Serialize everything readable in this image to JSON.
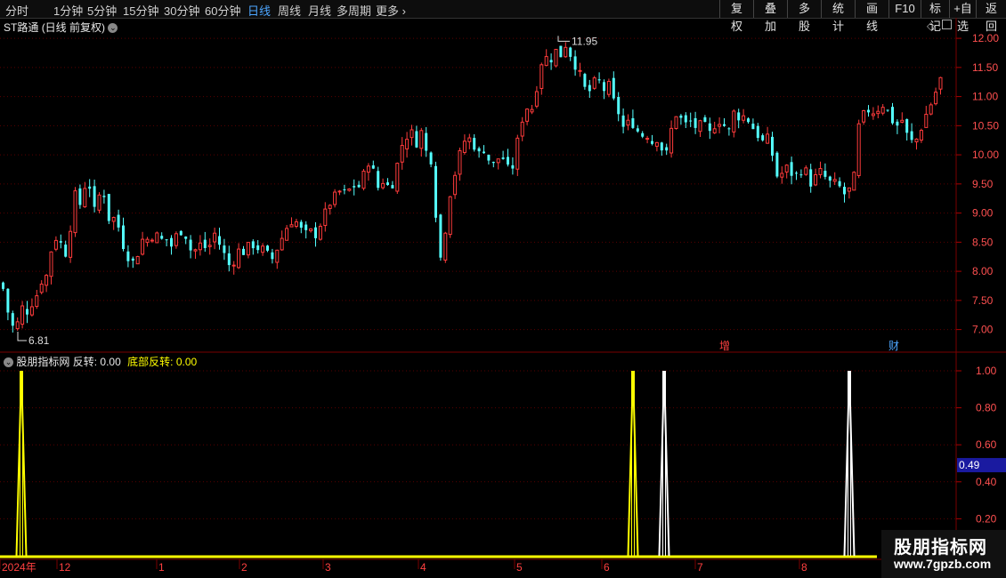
{
  "toolbar": {
    "periods": [
      "分时",
      "1分钟",
      "5分钟",
      "15分钟",
      "30分钟",
      "60分钟",
      "日线",
      "周线",
      "月线",
      "多周期",
      "更多"
    ],
    "active_period": "日线",
    "right_buttons": [
      "复权",
      "叠加",
      "多股",
      "统计",
      "画线",
      "F10",
      "标记",
      "+自选",
      "返回"
    ]
  },
  "main_chart": {
    "stock_title": "ST路通",
    "mode": "(日线 前复权)",
    "high_marker": "11.95",
    "low_marker": "6.81",
    "event_tags": [
      "增",
      "财"
    ],
    "colors": {
      "up": "#ff3b3b",
      "down": "#54ffff",
      "grid": "#5a0000"
    },
    "chart_data": {
      "type": "candlestick",
      "y_ticks": [
        "12.00",
        "11.50",
        "11.00",
        "10.50",
        "10.00",
        "9.50",
        "9.00",
        "8.50",
        "8.00",
        "7.50",
        "7.00"
      ],
      "ylim": [
        6.6,
        12.2
      ],
      "close_path": [
        [
          0,
          7.8
        ],
        [
          4,
          7.6
        ],
        [
          8,
          7.25
        ],
        [
          14,
          7.0
        ],
        [
          20,
          7.15
        ],
        [
          24,
          7.4
        ],
        [
          30,
          7.3
        ],
        [
          34,
          7.45
        ],
        [
          40,
          7.6
        ],
        [
          44,
          7.9
        ],
        [
          48,
          7.7
        ],
        [
          55,
          8.3
        ],
        [
          60,
          8.6
        ],
        [
          66,
          8.5
        ],
        [
          72,
          8.3
        ],
        [
          78,
          8.8
        ],
        [
          84,
          9.4
        ],
        [
          88,
          9.1
        ],
        [
          92,
          9.6
        ],
        [
          96,
          9.3
        ],
        [
          100,
          9.5
        ],
        [
          104,
          9.0
        ],
        [
          110,
          9.3
        ],
        [
          114,
          9.5
        ],
        [
          118,
          9.0
        ],
        [
          124,
          8.8
        ],
        [
          128,
          9.0
        ],
        [
          134,
          8.6
        ],
        [
          140,
          8.3
        ],
        [
          146,
          8.2
        ],
        [
          150,
          8.1
        ],
        [
          156,
          8.5
        ],
        [
          162,
          8.6
        ],
        [
          166,
          8.5
        ],
        [
          172,
          8.7
        ],
        [
          178,
          8.5
        ],
        [
          184,
          8.6
        ],
        [
          190,
          8.4
        ],
        [
          196,
          8.6
        ],
        [
          202,
          8.7
        ],
        [
          208,
          8.6
        ],
        [
          214,
          8.3
        ],
        [
          220,
          8.4
        ],
        [
          226,
          8.5
        ],
        [
          232,
          8.3
        ],
        [
          238,
          8.7
        ],
        [
          244,
          8.5
        ],
        [
          250,
          8.3
        ],
        [
          256,
          8.1
        ],
        [
          262,
          8.2
        ],
        [
          268,
          8.4
        ],
        [
          274,
          8.3
        ],
        [
          280,
          8.5
        ],
        [
          286,
          8.4
        ],
        [
          292,
          8.4
        ],
        [
          298,
          8.3
        ],
        [
          304,
          8.2
        ],
        [
          310,
          8.4
        ],
        [
          316,
          8.6
        ],
        [
          322,
          8.8
        ],
        [
          328,
          8.9
        ],
        [
          334,
          8.8
        ],
        [
          340,
          8.6
        ],
        [
          346,
          8.7
        ],
        [
          352,
          8.6
        ],
        [
          358,
          8.8
        ],
        [
          364,
          9.0
        ],
        [
          370,
          9.2
        ],
        [
          376,
          9.3
        ],
        [
          382,
          9.4
        ],
        [
          388,
          9.3
        ],
        [
          394,
          9.5
        ],
        [
          400,
          9.4
        ],
        [
          406,
          9.6
        ],
        [
          412,
          9.9
        ],
        [
          418,
          9.7
        ],
        [
          424,
          9.4
        ],
        [
          430,
          9.6
        ],
        [
          436,
          9.4
        ],
        [
          442,
          9.6
        ],
        [
          448,
          10.1
        ],
        [
          454,
          10.3
        ],
        [
          460,
          10.4
        ],
        [
          466,
          10.2
        ],
        [
          472,
          10.4
        ],
        [
          478,
          10.0
        ],
        [
          484,
          9.9
        ],
        [
          488,
          9.0
        ],
        [
          492,
          8.3
        ],
        [
          496,
          8.1
        ],
        [
          500,
          9.0
        ],
        [
          506,
          9.5
        ],
        [
          512,
          9.8
        ],
        [
          518,
          10.2
        ],
        [
          524,
          10.3
        ],
        [
          530,
          10.2
        ],
        [
          536,
          10.0
        ],
        [
          542,
          10.1
        ],
        [
          548,
          9.9
        ],
        [
          554,
          9.8
        ],
        [
          560,
          10.0
        ],
        [
          566,
          9.9
        ],
        [
          572,
          9.6
        ],
        [
          578,
          10.1
        ],
        [
          584,
          10.5
        ],
        [
          588,
          10.9
        ],
        [
          594,
          10.7
        ],
        [
          600,
          11.0
        ],
        [
          604,
          11.5
        ],
        [
          610,
          11.7
        ],
        [
          616,
          11.6
        ],
        [
          622,
          11.8
        ],
        [
          628,
          11.7
        ],
        [
          634,
          11.9
        ],
        [
          640,
          11.7
        ],
        [
          646,
          11.5
        ],
        [
          652,
          11.3
        ],
        [
          658,
          11.0
        ],
        [
          664,
          11.2
        ],
        [
          670,
          11.3
        ],
        [
          676,
          11.1
        ],
        [
          682,
          11.2
        ],
        [
          688,
          10.9
        ],
        [
          694,
          10.7
        ],
        [
          700,
          10.4
        ],
        [
          706,
          10.6
        ],
        [
          712,
          10.5
        ],
        [
          718,
          10.3
        ],
        [
          724,
          10.4
        ],
        [
          730,
          10.2
        ],
        [
          736,
          10.3
        ],
        [
          742,
          10.1
        ],
        [
          748,
          10.0
        ],
        [
          752,
          10.4
        ],
        [
          758,
          10.7
        ],
        [
          764,
          10.6
        ],
        [
          770,
          10.5
        ],
        [
          776,
          10.6
        ],
        [
          782,
          10.4
        ],
        [
          788,
          10.6
        ],
        [
          794,
          10.3
        ],
        [
          800,
          10.5
        ],
        [
          806,
          10.6
        ],
        [
          812,
          10.5
        ],
        [
          818,
          10.4
        ],
        [
          824,
          10.8
        ],
        [
          830,
          10.6
        ],
        [
          836,
          10.7
        ],
        [
          842,
          10.5
        ],
        [
          848,
          10.4
        ],
        [
          854,
          10.2
        ],
        [
          860,
          10.3
        ],
        [
          866,
          10.0
        ],
        [
          872,
          9.6
        ],
        [
          878,
          9.7
        ],
        [
          884,
          9.8
        ],
        [
          890,
          9.6
        ],
        [
          896,
          9.7
        ],
        [
          902,
          9.8
        ],
        [
          908,
          9.5
        ],
        [
          914,
          9.6
        ],
        [
          920,
          9.7
        ],
        [
          926,
          9.6
        ],
        [
          932,
          9.5
        ],
        [
          938,
          9.5
        ],
        [
          944,
          9.4
        ],
        [
          948,
          9.3
        ],
        [
          952,
          9.4
        ],
        [
          956,
          9.3
        ],
        [
          960,
          10.0
        ],
        [
          964,
          10.6
        ],
        [
          970,
          10.7
        ],
        [
          976,
          10.8
        ],
        [
          982,
          10.7
        ],
        [
          988,
          10.9
        ],
        [
          994,
          10.8
        ],
        [
          1000,
          10.6
        ],
        [
          1006,
          10.5
        ],
        [
          1012,
          10.6
        ],
        [
          1018,
          10.3
        ],
        [
          1024,
          10.2
        ],
        [
          1030,
          10.3
        ],
        [
          1036,
          10.6
        ],
        [
          1042,
          10.8
        ],
        [
          1048,
          11.0
        ],
        [
          1052,
          11.2
        ],
        [
          1058,
          11.4
        ]
      ]
    }
  },
  "indicator_panel": {
    "name": "股朋指标网",
    "label1": "反转",
    "value1": "0.00",
    "label2": "底部反转",
    "value2": "0.00",
    "y_ticks": [
      "1.00",
      "0.80",
      "0.60",
      "0.40",
      "0.20"
    ],
    "current_value": "0.49",
    "colors": {
      "yellow": "#ffff00",
      "white": "#ffffff"
    },
    "chart_data": {
      "type": "spike",
      "ylim": [
        0,
        1.05
      ],
      "series": [
        {
          "color": "yellow",
          "x_positions": [
            24,
            711
          ],
          "value": 1.0
        },
        {
          "color": "white",
          "x_positions": [
            746,
            954
          ],
          "value": 1.0
        }
      ]
    }
  },
  "x_axis": {
    "labels": [
      "2024年",
      "12",
      "1",
      "2",
      "3",
      "4",
      "5",
      "6",
      "7",
      "8"
    ]
  },
  "watermark": {
    "text": "股朋指标网",
    "url": "www.7gpzb.com"
  }
}
